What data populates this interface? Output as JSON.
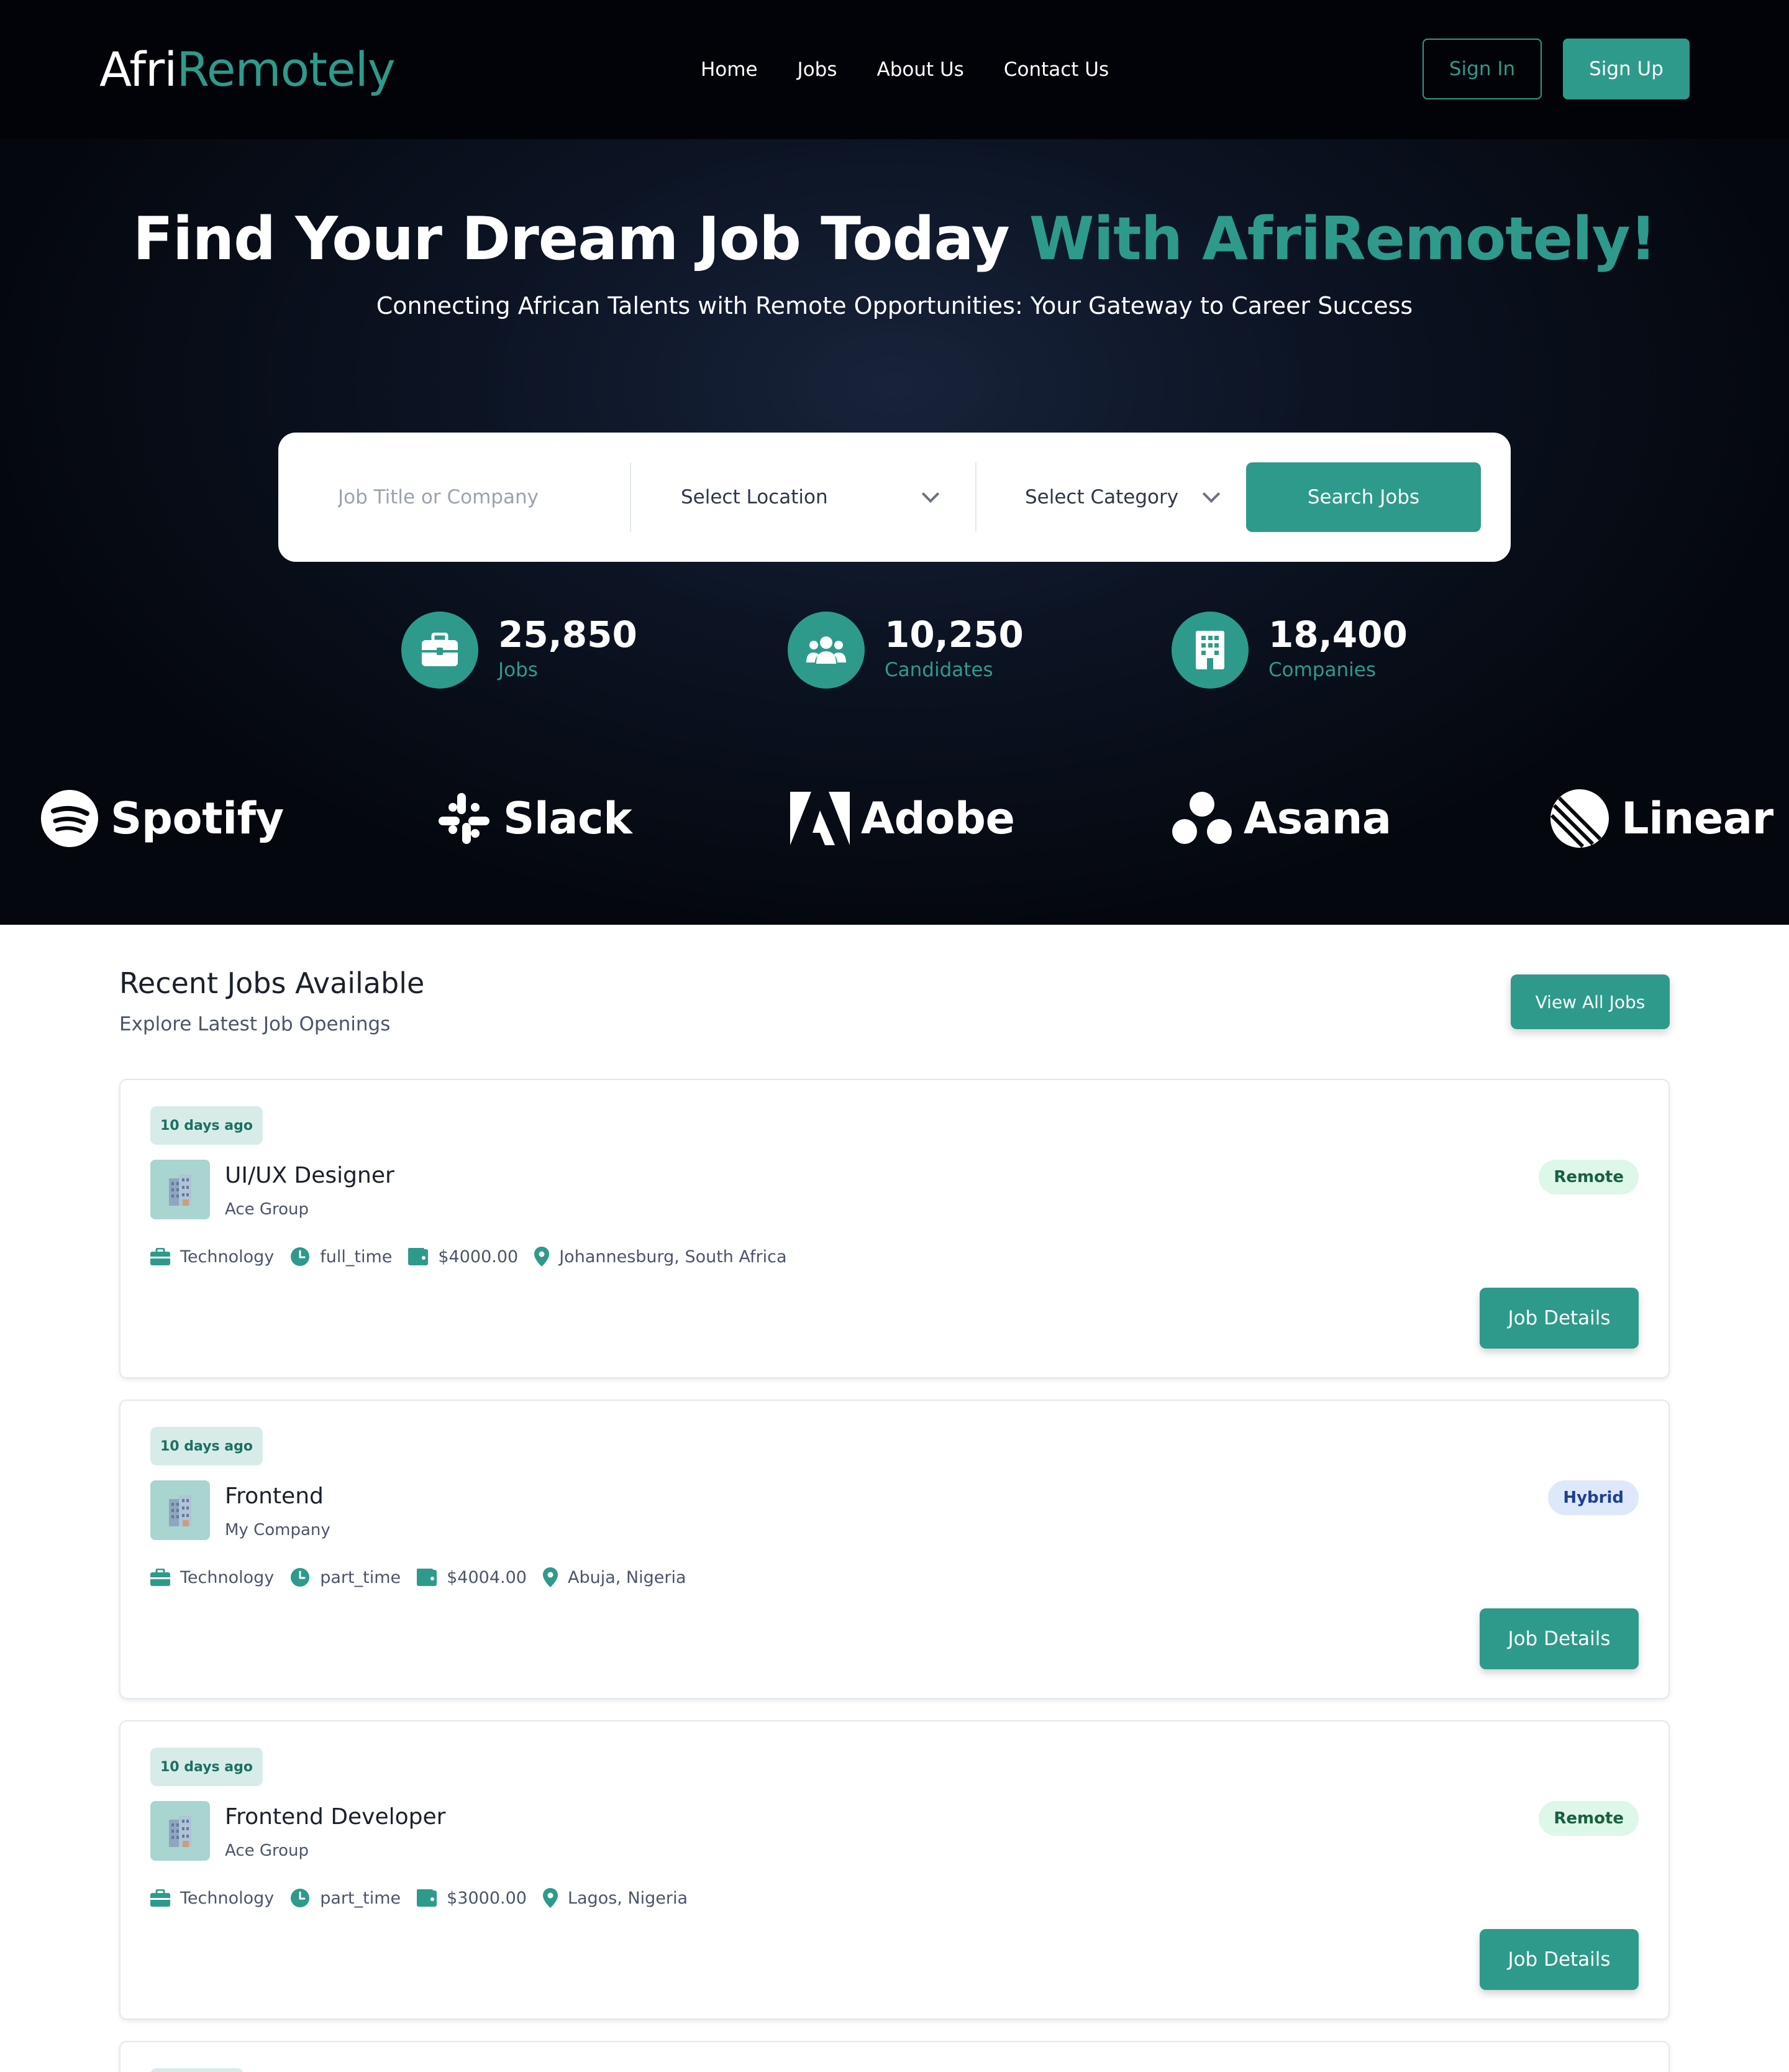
{
  "brand": {
    "part1": "Afri",
    "part2": "Remotely"
  },
  "nav": {
    "links": [
      "Home",
      "Jobs",
      "About Us",
      "Contact Us"
    ],
    "sign_in": "Sign In",
    "sign_up": "Sign Up"
  },
  "hero": {
    "title_main": "Find Your Dream Job Today ",
    "title_accent": "With AfriRemotely!",
    "subtitle": "Connecting African Talents with Remote Opportunities: Your Gateway to Career Success"
  },
  "search": {
    "placeholder": "Job Title or Company",
    "location_label": "Select Location",
    "category_label": "Select Category",
    "button_label": "Search Jobs"
  },
  "stats": [
    {
      "value": "25,850",
      "label": "Jobs",
      "icon": "briefcase-icon"
    },
    {
      "value": "10,250",
      "label": "Candidates",
      "icon": "users-icon"
    },
    {
      "value": "18,400",
      "label": "Companies",
      "icon": "building-icon"
    }
  ],
  "companies": [
    "Spotify",
    "Slack",
    "Adobe",
    "Asana",
    "Linear"
  ],
  "recent": {
    "title": "Recent Jobs Available",
    "subtitle": "Explore Latest Job Openings",
    "view_all": "View All Jobs"
  },
  "jobs": [
    {
      "posted": "10 days ago",
      "title": "UI/UX Designer",
      "company": "Ace Group",
      "category": "Technology",
      "type": "full_time",
      "salary": "$4000.00",
      "location": "Johannesburg, South Africa",
      "work_mode": "Remote",
      "action": "Job Details"
    },
    {
      "posted": "10 days ago",
      "title": "Frontend",
      "company": "My Company",
      "category": "Technology",
      "type": "part_time",
      "salary": "$4004.00",
      "location": "Abuja, Nigeria",
      "work_mode": "Hybrid",
      "action": "Job Details"
    },
    {
      "posted": "10 days ago",
      "title": "Frontend Developer",
      "company": "Ace Group",
      "category": "Technology",
      "type": "part_time",
      "salary": "$3000.00",
      "location": "Lagos, Nigeria",
      "work_mode": "Remote",
      "action": "Job Details"
    }
  ],
  "colors": {
    "accent": "#2e9a8b",
    "hero_bg": "#0c1424",
    "remote_badge": "#ddf7e8",
    "hybrid_badge": "#dde8fb"
  }
}
